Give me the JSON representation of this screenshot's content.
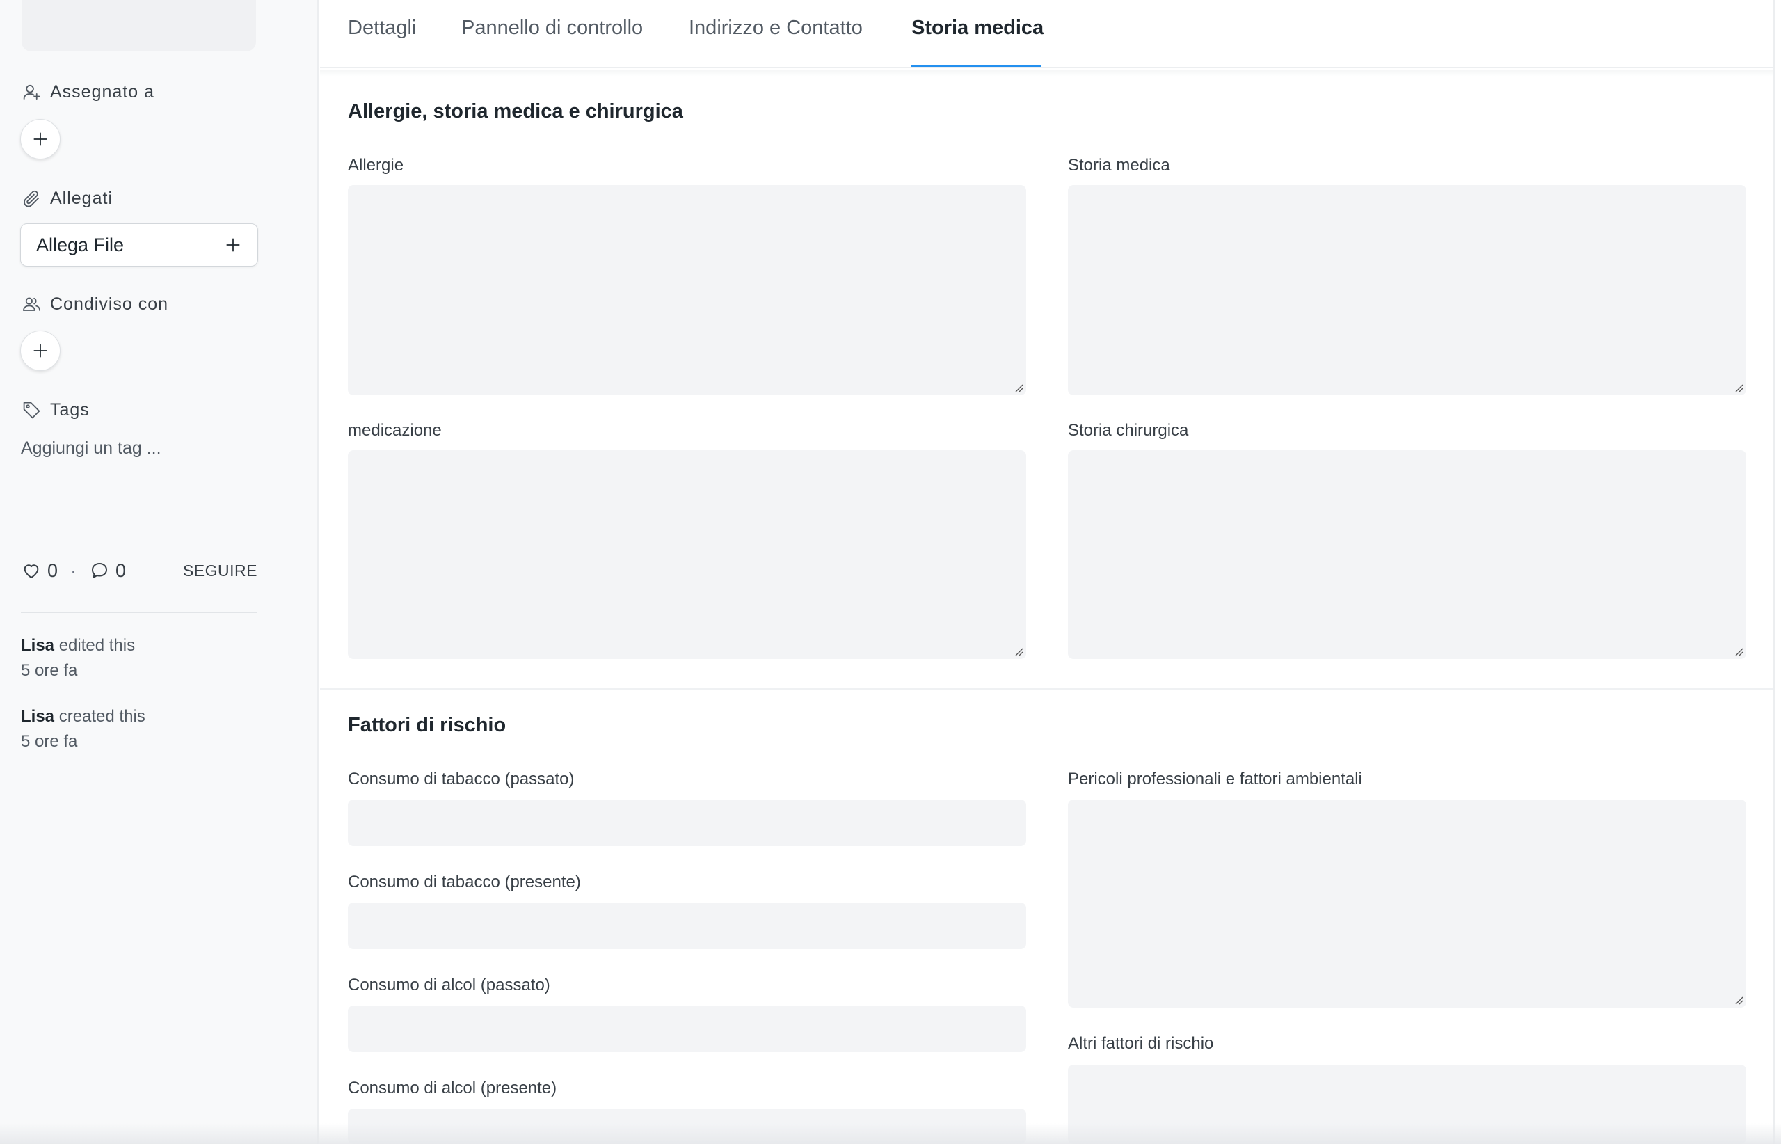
{
  "sidebar": {
    "assigned_label": "Assegnato a",
    "attachments_label": "Allegati",
    "attach_file_label": "Allega File",
    "shared_label": "Condiviso con",
    "tags_label": "Tags",
    "add_tag_label": "Aggiungi un tag ...",
    "likes": "0",
    "separator": "·",
    "comments": "0",
    "follow_label": "SEGUIRE",
    "activity": [
      {
        "user": "Lisa",
        "action": "edited this",
        "time": "5 ore fa"
      },
      {
        "user": "Lisa",
        "action": "created this",
        "time": "5 ore fa"
      }
    ]
  },
  "tabs": [
    {
      "label": "Dettagli",
      "active": false
    },
    {
      "label": "Pannello di controllo",
      "active": false
    },
    {
      "label": "Indirizzo e Contatto",
      "active": false
    },
    {
      "label": "Storia medica",
      "active": true
    }
  ],
  "sections": {
    "history": {
      "title": "Allergie, storia medica e chirurgica",
      "fields": {
        "allergies": {
          "label": "Allergie",
          "value": ""
        },
        "medical_history": {
          "label": "Storia medica",
          "value": ""
        },
        "medication": {
          "label": "medicazione",
          "value": ""
        },
        "surgical_history": {
          "label": "Storia chirurgica",
          "value": ""
        }
      }
    },
    "risk": {
      "title": "Fattori di rischio",
      "fields": {
        "tobacco_past": {
          "label": "Consumo di tabacco (passato)",
          "value": ""
        },
        "tobacco_current": {
          "label": "Consumo di tabacco (presente)",
          "value": ""
        },
        "alcohol_past": {
          "label": "Consumo di alcol (passato)",
          "value": ""
        },
        "alcohol_current": {
          "label": "Consumo di alcol (presente)",
          "value": ""
        },
        "occupational_hazards": {
          "label": "Pericoli professionali e fattori ambientali",
          "value": ""
        },
        "other_risk_factors": {
          "label": "Altri fattori di rischio",
          "value": ""
        }
      }
    }
  },
  "colors": {
    "accent": "#2490ef",
    "field_bg": "#f3f4f6",
    "sidebar_bg": "#f8f9fa",
    "text": "#1f272e"
  }
}
